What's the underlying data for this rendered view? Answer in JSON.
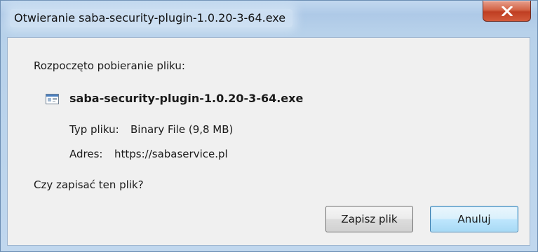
{
  "window": {
    "title": "Otwieranie saba-security-plugin-1.0.20-3-64.exe"
  },
  "dialog": {
    "started_label": "Rozpoczęto pobieranie pliku:",
    "file": {
      "name": "saba-security-plugin-1.0.20-3-64.exe",
      "icon": "executable-file-icon"
    },
    "type_key": "Typ pliku:",
    "type_value": "Binary File (9,8 MB)",
    "address_key": "Adres:",
    "address_value": "https://sabaservice.pl",
    "question": "Czy zapisać ten plik?"
  },
  "buttons": {
    "save": "Zapisz plik",
    "cancel": "Anuluj"
  },
  "colors": {
    "title_bar": "#b7d1ea",
    "close_button": "#c84a2d",
    "dialog_bg": "#f0f0f0",
    "focused_button_border": "#3c7fb1"
  }
}
